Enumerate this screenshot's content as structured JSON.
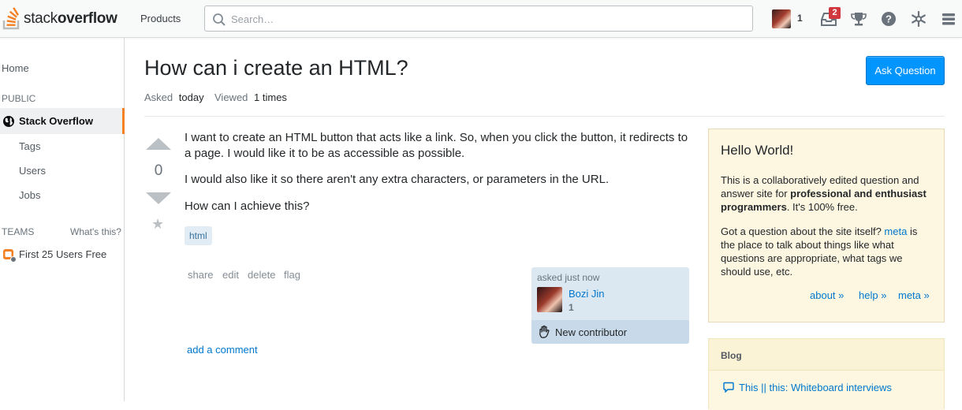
{
  "header": {
    "logo_text_plain": "stack",
    "logo_text_bold": "overflow",
    "products_label": "Products",
    "search_placeholder": "Search…",
    "reputation": "1",
    "inbox_count": "2"
  },
  "leftnav": {
    "home": "Home",
    "public_label": "PUBLIC",
    "stack_overflow": "Stack Overflow",
    "items": [
      "Tags",
      "Users",
      "Jobs"
    ],
    "teams_label": "TEAMS",
    "whats_this": "What's this?",
    "first_users_free": "First 25 Users Free"
  },
  "question": {
    "title": "How can i create an HTML?",
    "ask_button": "Ask Question",
    "asked_label": "Asked",
    "asked_value": "today",
    "viewed_label": "Viewed",
    "viewed_value": "1 times",
    "vote_count": "0",
    "body_p1": "I want to create an HTML button that acts like a link. So, when you click the button, it redirects to a page. I would like it to be as accessible as possible.",
    "body_p2": "I would also like it so there aren't any extra characters, or parameters in the URL.",
    "body_p3": "How can I achieve this?",
    "tag": "html",
    "menu": [
      "share",
      "edit",
      "delete",
      "flag"
    ],
    "add_comment": "add a comment"
  },
  "owner": {
    "asked_time": "asked just now",
    "name": "Bozi Jin",
    "reputation": "1",
    "new_contributor": "New contributor"
  },
  "sidebar": {
    "hello_title": "Hello World!",
    "p1_start": "This is a collaboratively edited question and answer site for ",
    "p1_bold": "professional and enthusiast programmers",
    "p1_end": ". It's 100% free.",
    "p2_start": "Got a question about the site itself? ",
    "p2_link": "meta",
    "p2_end": " is the place to talk about things like what questions are appropriate, what tags we should use, etc.",
    "links": [
      "about »",
      "help »",
      "meta »"
    ],
    "blog_title": "Blog",
    "blog_item": "This || this: Whiteboard interviews"
  },
  "colors": {
    "accent_orange": "#f48024",
    "ask_button_blue": "#0095ff",
    "link_blue": "#0077cc",
    "notice_yellow": "#fdf7e2",
    "badge_red": "#d1383d"
  },
  "icons": [
    "stack-overflow-logo-icon",
    "search-icon",
    "inbox-icon",
    "trophy-icon",
    "help-icon",
    "stack-exchange-icon",
    "menu-icon",
    "globe-icon",
    "team-icon",
    "hand-wave-icon",
    "speech-bubble-icon",
    "star-icon"
  ]
}
